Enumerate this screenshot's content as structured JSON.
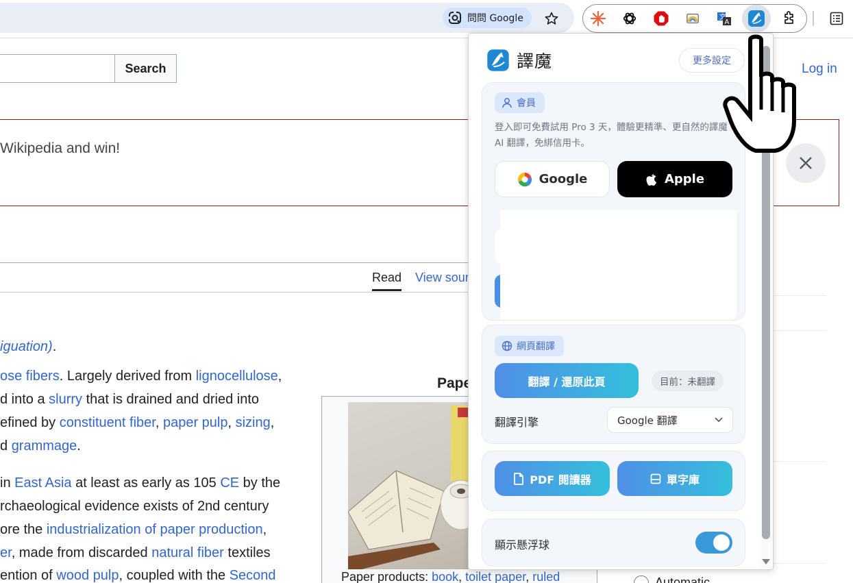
{
  "chrome": {
    "ask_google": "問問 Google",
    "extensions": [
      "perplexity-icon",
      "openai-icon",
      "ublock-icon",
      "rainbow-icon",
      "translate-icon",
      "immersive-translate-icon"
    ],
    "accent": "#d3e3fd"
  },
  "wiki": {
    "search_button": "Search",
    "login": "Log in",
    "banner_text": "Wikipedia and win!",
    "tabs": {
      "read": "Read",
      "view_source": "View source"
    },
    "lines": [
      {
        "parts": [
          {
            "t": "iguation)",
            "link": true,
            "ital": true
          },
          {
            "t": "."
          }
        ]
      },
      {
        "parts": [
          {
            "t": "ose fibers",
            "link": true
          },
          {
            "t": ". Largely derived from "
          },
          {
            "t": "lignocellulose",
            "link": true
          },
          {
            "t": ","
          }
        ]
      },
      {
        "parts": [
          {
            "t": "d into a "
          },
          {
            "t": "slurry",
            "link": true
          },
          {
            "t": " that is drained and dried into"
          }
        ]
      },
      {
        "parts": [
          {
            "t": "efined by "
          },
          {
            "t": "constituent fiber",
            "link": true
          },
          {
            "t": ", "
          },
          {
            "t": "paper pulp",
            "link": true
          },
          {
            "t": ", "
          },
          {
            "t": "sizing",
            "link": true
          },
          {
            "t": ","
          }
        ]
      },
      {
        "parts": [
          {
            "t": "d "
          },
          {
            "t": "grammage",
            "link": true
          },
          {
            "t": "."
          }
        ]
      },
      {
        "parts": [
          {
            "t": "in "
          },
          {
            "t": "East Asia",
            "link": true
          },
          {
            "t": " at least as early as 105 "
          },
          {
            "t": "CE",
            "link": true
          },
          {
            "t": " by the"
          }
        ]
      },
      {
        "parts": [
          {
            "t": "rchaeological evidence exists of 2nd century"
          }
        ]
      },
      {
        "parts": [
          {
            "t": "ore the "
          },
          {
            "t": "industrialization of paper production",
            "link": true
          },
          {
            "t": ","
          }
        ]
      },
      {
        "parts": [
          {
            "t": "er",
            "link": true
          },
          {
            "t": ", made from discarded "
          },
          {
            "t": "natural fiber",
            "link": true
          },
          {
            "t": " textiles"
          }
        ]
      },
      {
        "parts": [
          {
            "t": "ention of "
          },
          {
            "t": "wood pulp",
            "link": true
          },
          {
            "t": ", coupled with the "
          },
          {
            "t": "Second",
            "link": true
          }
        ]
      }
    ],
    "infobox_title": "Paper",
    "caption_parts": [
      {
        "t": "Paper products: "
      },
      {
        "t": "book",
        "link": true
      },
      {
        "t": ", "
      },
      {
        "t": "toilet paper",
        "link": true
      },
      {
        "t": ", "
      },
      {
        "t": "ruled",
        "link": true
      }
    ],
    "radio_label": "Automatic"
  },
  "popup": {
    "brand": "譯魔",
    "more_settings": "更多設定",
    "member": {
      "tag": "會員",
      "desc": "登入即可免費試用 Pro 3 天，體驗更精準、更自然的譯魔 AI 翻譯，免綁信用卡。",
      "google": "Google",
      "apple": "Apple"
    },
    "web": {
      "tag": "網頁翻譯",
      "translate_btn": "翻譯 / 還原此頁",
      "status": "目前：未翻譯",
      "engine_label": "翻譯引擎",
      "engine_value": "Google 翻譯"
    },
    "tools": {
      "pdf": "PDF 閱讀器",
      "vocab": "單字庫"
    },
    "float_ball": {
      "label": "顯示懸浮球",
      "enabled": true
    },
    "colors": {
      "primary": "#4f8fe6",
      "secondary": "#35bfdc",
      "toggle": "#3a9ad9"
    }
  }
}
